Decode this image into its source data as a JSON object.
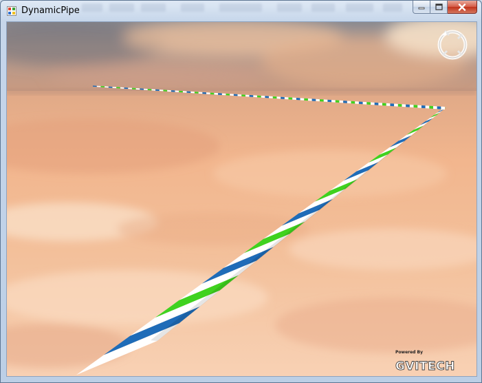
{
  "window": {
    "title": "DynamicPipe",
    "app_icon": "windows-form-icon",
    "controls": [
      "minimize-icon",
      "maximize-icon",
      "close-icon"
    ]
  },
  "viewport": {
    "compass_icon": "compass-navigation-icon",
    "watermark": {
      "powered_by": "Powered By",
      "brand": "GVITECH",
      "logo_icon": "gvitech-logo-icon"
    },
    "colors": {
      "sky_top": "#c9a894",
      "horizon": "#ba8e79",
      "ground_mid": "#f0b58a",
      "ground_near": "#f8cfae",
      "pipe_blue": "#1f6cb8",
      "pipe_green": "#3fd21f",
      "pipe_white": "#ffffff"
    }
  }
}
